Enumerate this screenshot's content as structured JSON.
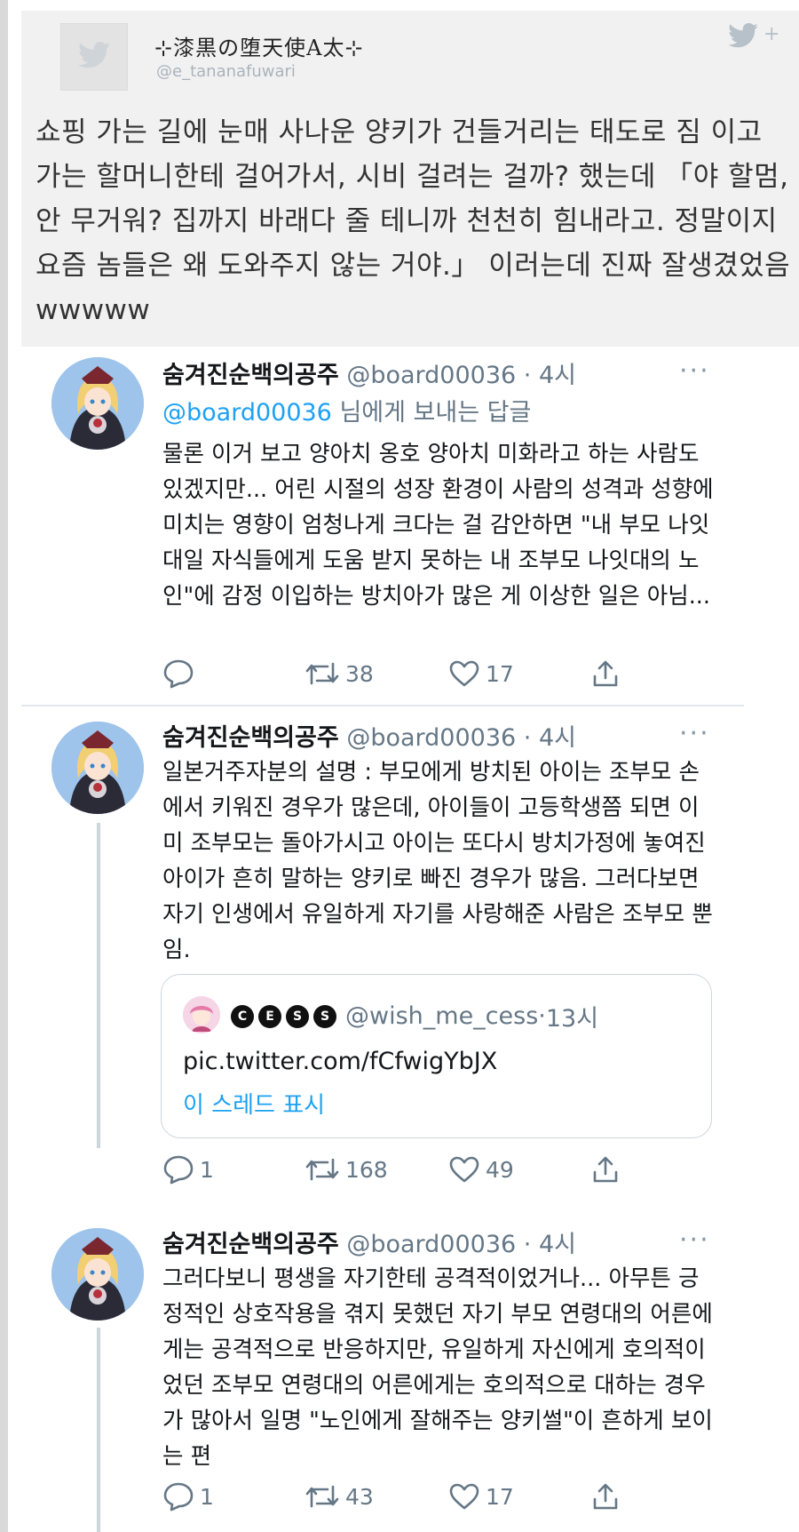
{
  "quoted": {
    "display_name": "⊹漆黒の堕天使A太⊹",
    "handle": "@e_tananafuwari",
    "text": "쇼핑 가는 길에 눈매 사나운 양키가 건들거리는 태도로 짐 이고 가는 할머니한테 걸어가서, 시비 걸려는 걸까? 했는데 「야 할멈, 안 무거워? 집까지 바래다 줄 테니까 천천히 힘내라고. 정말이지 요즘 놈들은 왜 도와주지 않는 거야.」 이러는데 진짜 잘생겼었음wwwww",
    "icon": "twitter-bird-icon",
    "plus": "+"
  },
  "tweets": [
    {
      "name": "숨겨진순백의공주",
      "handle": "@board00036",
      "dot": "·",
      "time": "4시",
      "more": "···",
      "reply_mention": "@board00036",
      "reply_suffix": " 님에게 보내는 답글",
      "text": "물론 이거 보고 양아치 옹호 양아치 미화라고 하는 사람도 있겠지만... 어린 시절의 성장 환경이 사람의 성격과 성향에 미치는 영향이 엄청나게 크다는 걸 감안하면 \"내 부모 나잇대일 자식들에게 도움 받지 못하는 내 조부모 나잇대의 노인\"에 감정 이입하는 방치아가 많은 게 이상한 일은 아님...",
      "replies": "",
      "retweets": "38",
      "likes": "17"
    },
    {
      "name": "숨겨진순백의공주",
      "handle": "@board00036",
      "dot": "·",
      "time": "4시",
      "more": "···",
      "text": "일본거주자분의 설명 : 부모에게 방치된 아이는 조부모 손에서 키워진 경우가 많은데, 아이들이 고등학생쯤 되면 이미 조부모는 돌아가시고 아이는 또다시 방치가정에 놓여진 아이가 흔히 말하는 양키로 빠진 경우가 많음. 그러다보면 자기 인생에서 유일하게 자기를 사랑해준 사람은 조부모 뿐임.",
      "quote": {
        "badges": [
          "C",
          "E",
          "S",
          "S"
        ],
        "handle": "@wish_me_cess",
        "dot": "·",
        "time": "13시",
        "link": "pic.twitter.com/fCfwigYbJX",
        "show_thread": "이 스레드 표시"
      },
      "replies": "1",
      "retweets": "168",
      "likes": "49"
    },
    {
      "name": "숨겨진순백의공주",
      "handle": "@board00036",
      "dot": "·",
      "time": "4시",
      "more": "···",
      "text": "그러다보니 평생을 자기한테 공격적이었거나... 아무튼 긍정적인 상호작용을 겪지 못했던 자기 부모 연령대의 어른에게는 공격적으로 반응하지만, 유일하게 자신에게 호의적이었던 조부모 연령대의 어른에게는 호의적으로 대하는 경우가 많아서 일명 \"노인에게 잘해주는 양키썰\"이 흔하게 보이는 편",
      "replies": "1",
      "retweets": "43",
      "likes": "17"
    }
  ],
  "colors": {
    "accent": "#1da1f2",
    "secondary_text": "#657786",
    "quoted_bg": "#f1f1f1",
    "thread_line": "#ccd6dd"
  }
}
